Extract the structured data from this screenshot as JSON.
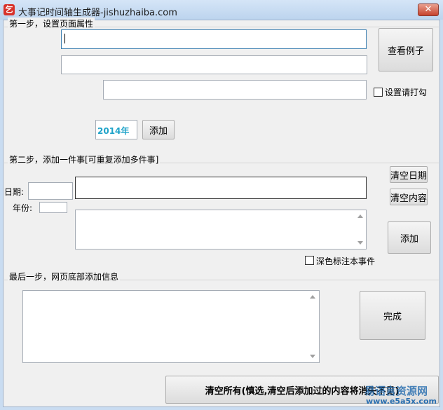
{
  "window": {
    "title": "大事记时间轴生成器-jishuzhaiba.com",
    "icon_glyph": "乞",
    "close_glyph": "✕"
  },
  "step1": {
    "legend": "第一步，设置页面属性",
    "example_button": "查看例子",
    "checkbox_label": "设置请打勾",
    "year_value": "2014年",
    "add_button": "添加"
  },
  "step2": {
    "legend": "第二步，添加一件事[可重复添加多件事]",
    "date_label": "日期:",
    "year_label": "年份:",
    "clear_date_button": "清空日期",
    "clear_content_button": "清空内容",
    "add_button": "添加",
    "dark_checkbox_label": "深色标注本事件"
  },
  "step3": {
    "legend": "最后一步，网页底部添加信息",
    "finish_button": "完成"
  },
  "footer": {
    "clear_all_button": "清空所有(慎选,清空后添加过的内容将消失不见)"
  },
  "watermark": {
    "line1": "易语言资源网",
    "line2": "www.e5a5x.com"
  }
}
